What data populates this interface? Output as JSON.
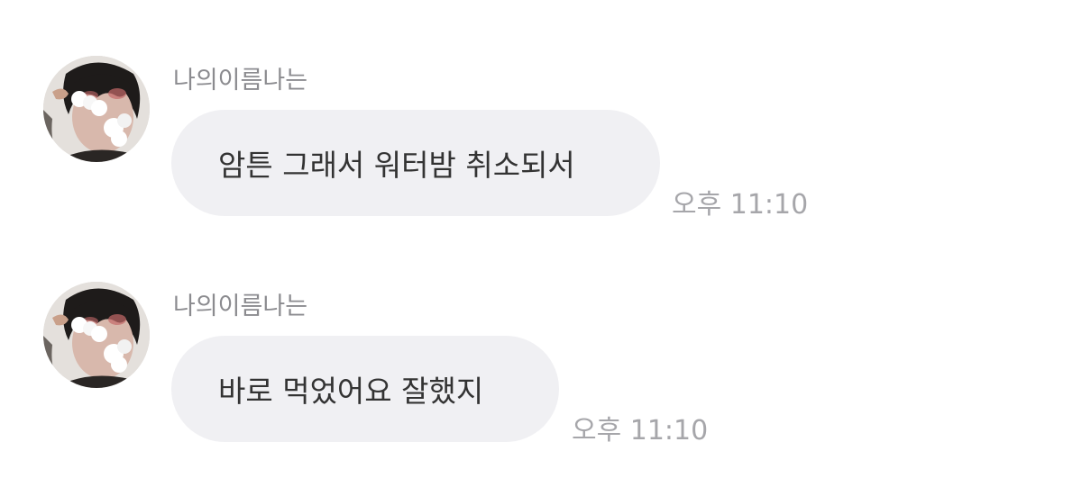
{
  "messages": [
    {
      "sender": "나의이름나는",
      "avatar_icon": "profile-photo-icon",
      "text": "암튼 그래서 워터밤 취소되서",
      "time": "오후 11:10"
    },
    {
      "sender": "나의이름나는",
      "avatar_icon": "profile-photo-icon",
      "text": "바로 먹었어요 잘했지",
      "time": "오후 11:10"
    }
  ],
  "colors": {
    "background": "#ffffff",
    "bubble": "#f0f0f3",
    "message_text": "#333333",
    "sender_text": "#8b8b8f",
    "time_text": "#a6a6aa"
  }
}
